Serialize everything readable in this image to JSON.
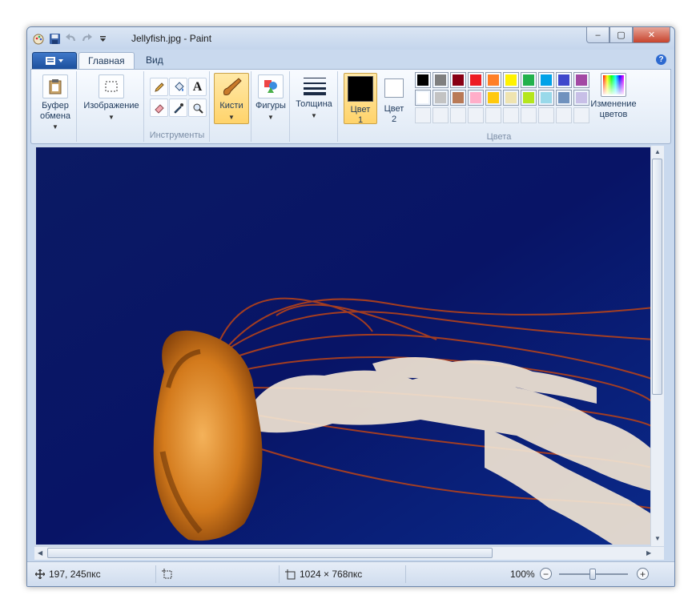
{
  "window": {
    "title": "Jellyfish.jpg - Paint"
  },
  "titlebar": {
    "quick_access": [
      "paint-app-icon",
      "save-icon",
      "undo-icon",
      "redo-icon",
      "customize-qat-icon"
    ],
    "controls": {
      "minimize": "‒",
      "maximize": "▢",
      "close": "✕"
    }
  },
  "tabs": [
    {
      "label": "Главная",
      "active": true
    },
    {
      "label": "Вид",
      "active": false
    }
  ],
  "app_menu": {
    "icon": "app-menu-icon"
  },
  "help": {
    "label": "?"
  },
  "ribbon": {
    "clipboard": {
      "label_line1": "Буфер",
      "label_line2": "обмена"
    },
    "image": {
      "label": "Изображение"
    },
    "tools": {
      "group_label": "Инструменты",
      "text_tool": "A"
    },
    "brushes": {
      "label": "Кисти"
    },
    "shapes": {
      "label": "Фигуры"
    },
    "size": {
      "label": "Толщина"
    },
    "color1": {
      "line1": "Цвет",
      "line2": "1"
    },
    "color2": {
      "line1": "Цвет",
      "line2": "2"
    },
    "colors": {
      "group_label": "Цвета",
      "row1": [
        "#000000",
        "#7f7f7f",
        "#880015",
        "#ed1c24",
        "#ff7f27",
        "#fff200",
        "#22b14c",
        "#00a2e8",
        "#3f48cc",
        "#a349a4"
      ],
      "row2": [
        "#ffffff",
        "#c3c3c3",
        "#b97a57",
        "#ffaec9",
        "#ffc90e",
        "#efe4b0",
        "#b5e61d",
        "#99d9ea",
        "#7092be",
        "#c8bfe7"
      ],
      "edit_line1": "Изменение",
      "edit_line2": "цветов"
    }
  },
  "canvas": {
    "description_colors": {
      "background": "#06105a",
      "jellyfish": "#e07a1f"
    }
  },
  "status": {
    "cursor_pos": "197, 245пкс",
    "image_size": "1024 × 768пкс",
    "zoom": "100%",
    "zoom_out": "−",
    "zoom_in": "+"
  }
}
